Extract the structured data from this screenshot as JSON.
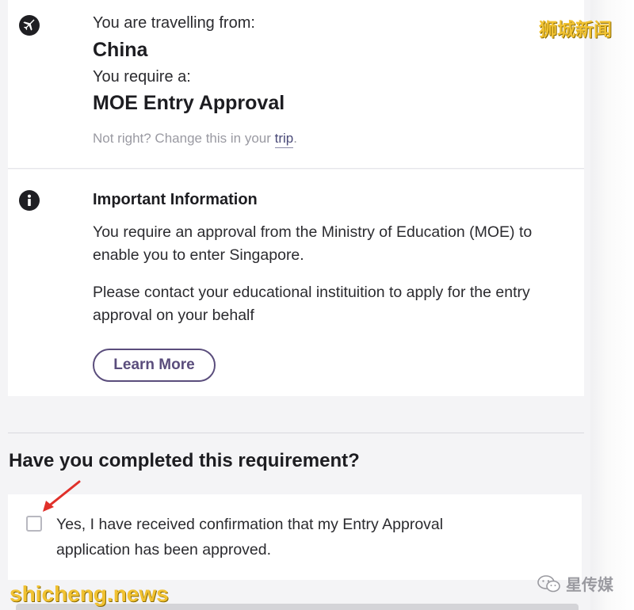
{
  "trip": {
    "from_label": "You are travelling from:",
    "from_value": "China",
    "require_label": "You require a:",
    "require_value": "MOE Entry Approval",
    "change_prefix": "Not right? Change this in your",
    "change_link": "trip",
    "change_suffix": ".",
    "icon": "airplane-icon"
  },
  "info": {
    "icon": "info-icon",
    "heading": "Important Information",
    "para1": "You require an approval from the Ministry of Education (MOE) to enable you to enter Singapore.",
    "para2": "Please contact your educational instituition to apply for the entry approval on your behalf",
    "learn_more_label": "Learn More"
  },
  "requirement": {
    "question": "Have you completed this requirement?",
    "checkbox_checked": false,
    "checkbox_label": "Yes, I have received confirmation that my Entry Approval application has been approved."
  },
  "watermarks": {
    "top_right": "狮城新闻",
    "bottom_left": "shicheng.news",
    "bottom_right": "星传媒"
  },
  "colors": {
    "accent": "#5a4d7c",
    "watermark": "#f1c232",
    "arrow": "#e0302a"
  }
}
